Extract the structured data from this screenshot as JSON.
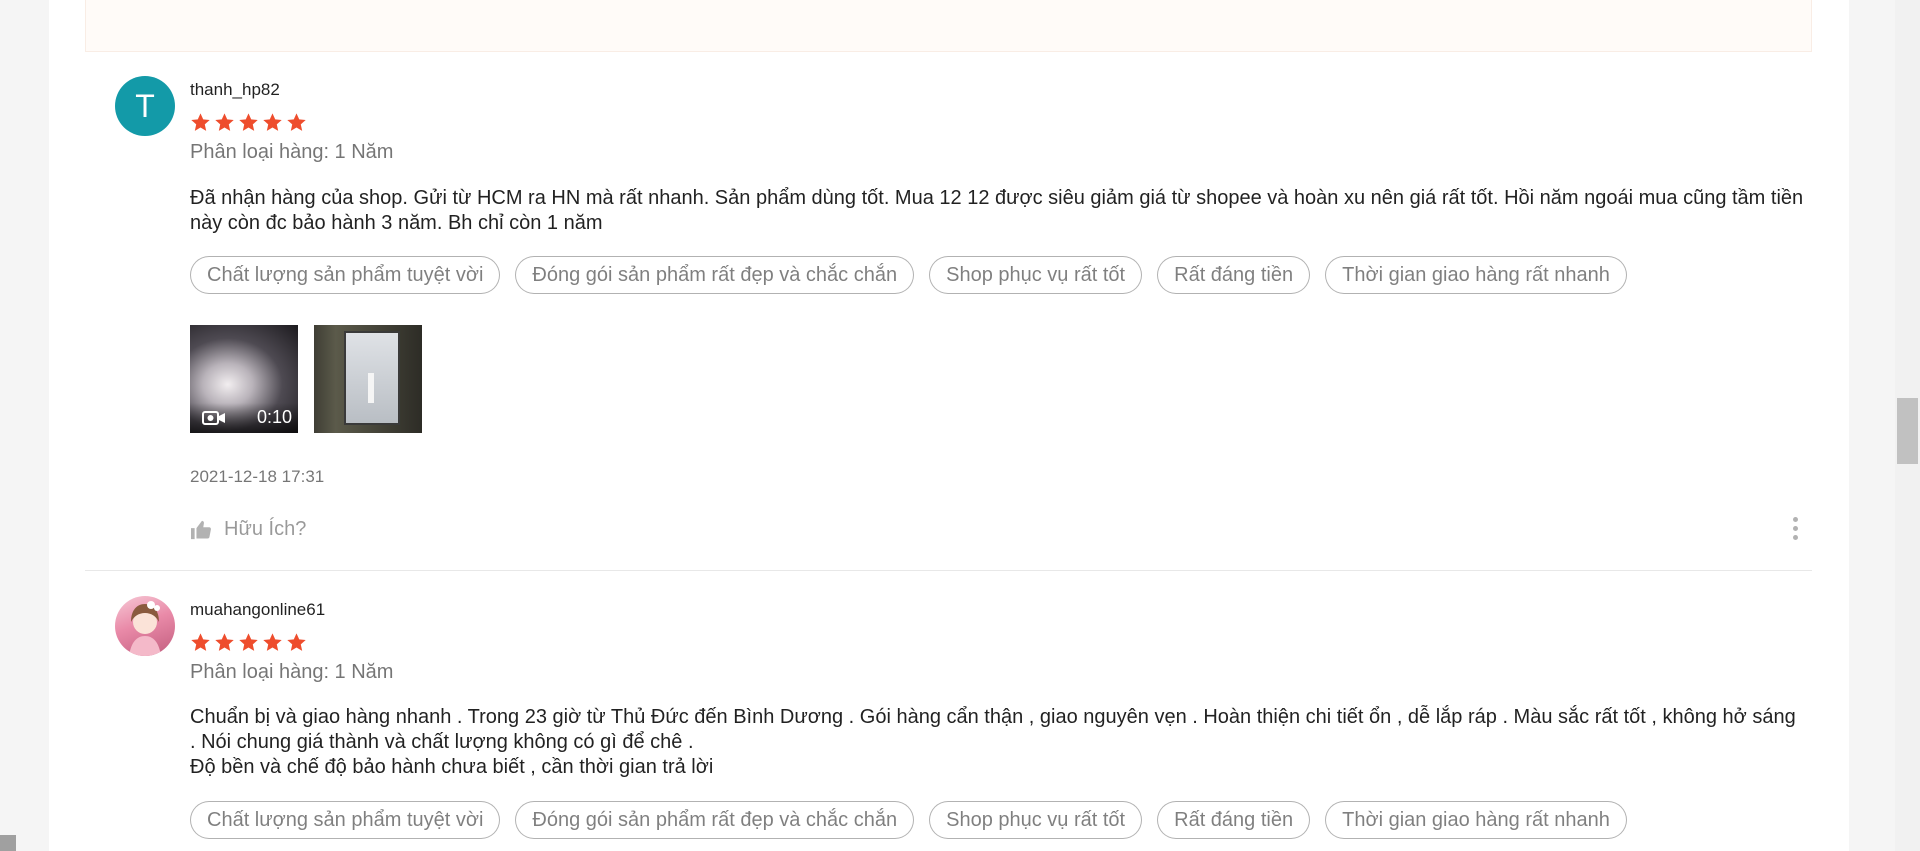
{
  "reviews": [
    {
      "author": "thanh_hp82",
      "avatar_letter": "T",
      "avatar_color": "#139aa8",
      "rating": 5,
      "variation": "Phân loại hàng: 1 Năm",
      "comment": "Đã nhận hàng của shop. Gửi từ HCM ra HN mà rất nhanh. Sản phẩm dùng tốt. Mua 12 12 được siêu giảm giá từ shopee và hoàn xu nên giá rất tốt. Hồi năm ngoái mua cũng tầm tiền này còn đc bảo hành 3 năm. Bh chỉ còn 1 năm",
      "tags": [
        "Chất lượng sản phẩm tuyệt vời",
        "Đóng gói sản phẩm rất đẹp và chắc chắn",
        "Shop phục vụ rất tốt",
        "Rất đáng tiền",
        "Thời gian giao hàng rất nhanh"
      ],
      "media": {
        "video_duration": "0:10"
      },
      "timestamp": "2021-12-18 17:31",
      "helpful_label": "Hữu Ích?"
    },
    {
      "author": "muahangonline61",
      "rating": 5,
      "variation": "Phân loại hàng: 1 Năm",
      "comment": "Chuẩn bị và giao hàng nhanh . Trong 23 giờ từ Thủ Đức đến Bình Dương . Gói hàng cẩn thận , giao nguyên vẹn . Hoàn thiện chi tiết ổn , dễ lắp ráp . Màu sắc rất tốt , không hở sáng . Nói chung giá thành và chất lượng không có gì để chê .\nĐộ bền và chế độ bảo hành chưa biết , cần thời gian trả lời",
      "tags": [
        "Chất lượng sản phẩm tuyệt vời",
        "Đóng gói sản phẩm rất đẹp và chắc chắn",
        "Shop phục vụ rất tốt",
        "Rất đáng tiền",
        "Thời gian giao hàng rất nhanh"
      ]
    }
  ],
  "colors": {
    "star": "#ee4d2d",
    "page_background": "#f5f5f5",
    "banner_background": "#fffbf8"
  }
}
